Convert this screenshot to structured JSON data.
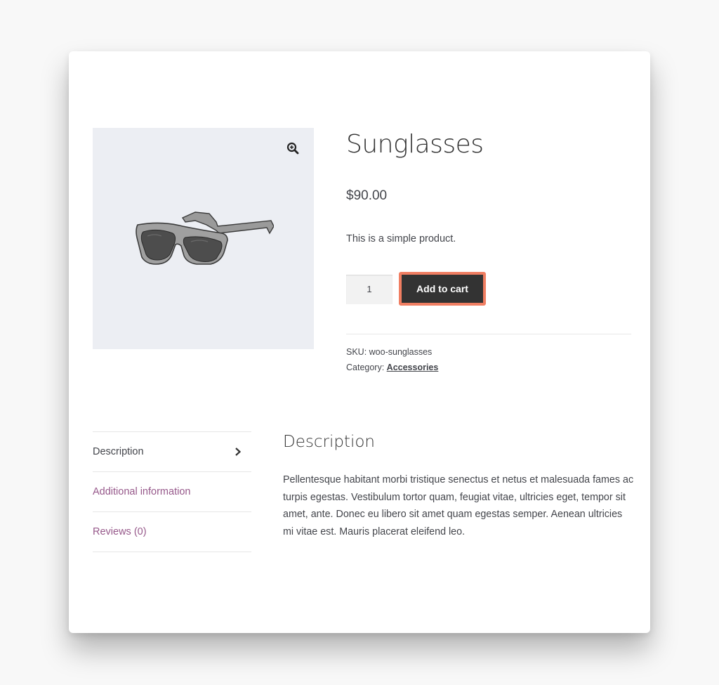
{
  "product": {
    "title": "Sunglasses",
    "price": "$90.00",
    "short_description": "This is a simple product.",
    "quantity": "1",
    "add_to_cart_label": "Add to cart",
    "sku_label": "SKU: ",
    "sku_value": "woo-sunglasses",
    "category_label": "Category: ",
    "category_value": "Accessories",
    "image_icon": "sunglasses-product-image",
    "zoom_icon": "zoom-in-icon"
  },
  "tabs": [
    {
      "label": "Description",
      "active": true
    },
    {
      "label": "Additional information",
      "active": false
    },
    {
      "label": "Reviews (0)",
      "active": false
    }
  ],
  "description_panel": {
    "heading": "Description",
    "body": "Pellentesque habitant morbi tristique senectus et netus et malesuada fames ac turpis egestas. Vestibulum tortor quam, feugiat vitae, ultricies eget, tempor sit amet, ante. Donec eu libero sit amet quam egestas semper. Aenean ultricies mi vitae est. Mauris placerat eleifend leo."
  },
  "colors": {
    "accent_link": "#96588a",
    "button_bg": "#333333",
    "button_highlight": "#f07e62",
    "image_bg": "#eceef3"
  }
}
